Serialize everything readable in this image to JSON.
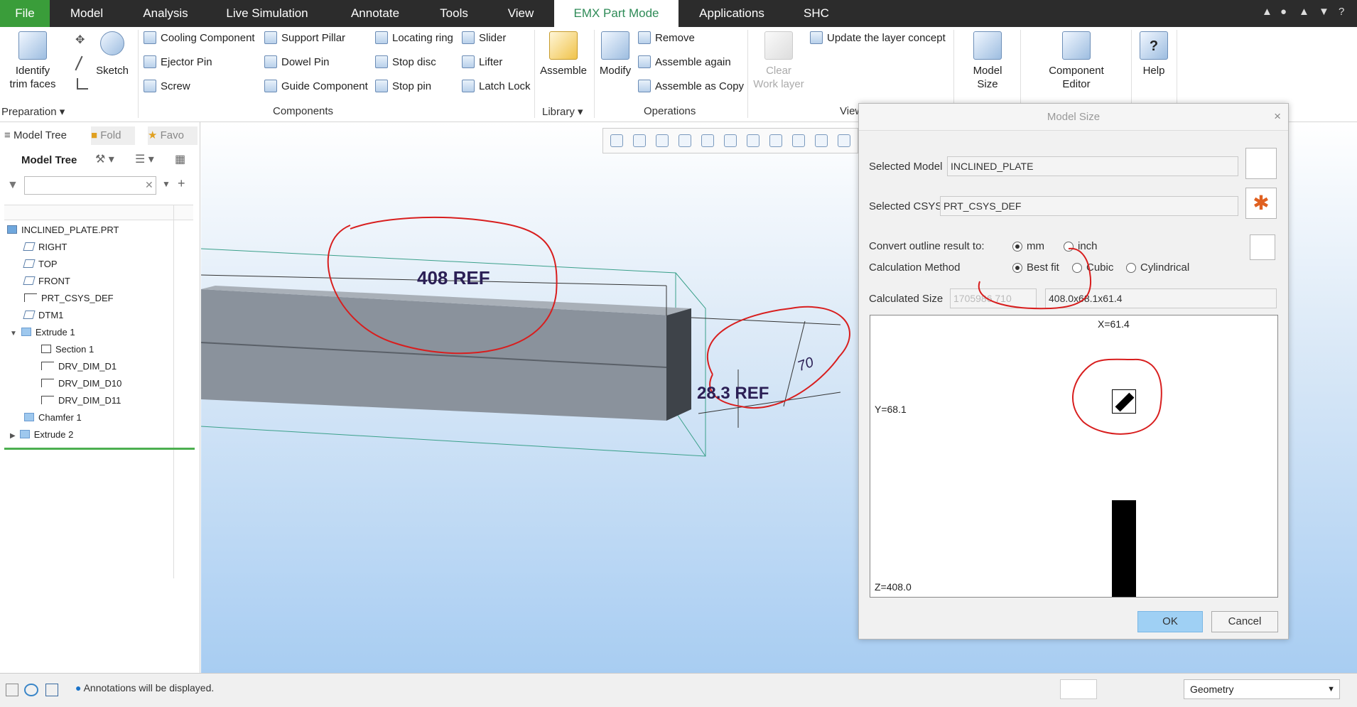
{
  "menubar": {
    "tabs": [
      "File",
      "Model",
      "Analysis",
      "Live Simulation",
      "Annotate",
      "Tools",
      "View",
      "EMX Part Mode",
      "Applications",
      "SHC"
    ],
    "active_tab": "EMX Part Mode",
    "help": "?"
  },
  "ribbon": {
    "identify_trim_faces": "Identify\ntrim faces",
    "sketch": "Sketch",
    "components": {
      "col1": [
        "Cooling Component",
        "Ejector Pin",
        "Screw"
      ],
      "col2": [
        "Support Pillar",
        "Dowel Pin",
        "Guide Component"
      ],
      "col3": [
        "Locating ring",
        "Stop disc",
        "Stop pin"
      ],
      "col4": [
        "Slider",
        "Lifter",
        "Latch Lock"
      ]
    },
    "assemble": "Assemble",
    "modify": "Modify",
    "operations": [
      "Remove",
      "Assemble again",
      "Assemble as Copy"
    ],
    "clear_work_layer": "Clear\nWork layer",
    "update_layer": "Update the layer concept",
    "model_size": "Model\nSize",
    "component_editor": "Component\nEditor",
    "help": "Help",
    "groups": {
      "preparation": "Preparation",
      "components": "Components",
      "library": "Library",
      "operations": "Operations",
      "view": "View"
    }
  },
  "left_panel": {
    "tabs": [
      "Model Tree",
      "Fold",
      "Favo"
    ],
    "tree_header": "Model Tree",
    "search_placeholder": "",
    "items": [
      {
        "label": "INCLINED_PLATE.PRT"
      },
      {
        "label": "RIGHT"
      },
      {
        "label": "TOP"
      },
      {
        "label": "FRONT"
      },
      {
        "label": "PRT_CSYS_DEF"
      },
      {
        "label": "DTM1"
      },
      {
        "label": "Extrude 1"
      },
      {
        "label": "Section 1"
      },
      {
        "label": "DRV_DIM_D1"
      },
      {
        "label": "DRV_DIM_D10"
      },
      {
        "label": "DRV_DIM_D11"
      },
      {
        "label": "Chamfer 1"
      },
      {
        "label": "Extrude 2"
      }
    ]
  },
  "viewport": {
    "dim_408": "408 REF",
    "dim_283": "28.3 REF",
    "dim_70": "70"
  },
  "dialog": {
    "title": "Model Size",
    "close": "×",
    "selected_model_label": "Selected Model",
    "selected_model_value": "INCLINED_PLATE",
    "selected_csys_label": "Selected CSYS",
    "selected_csys_value": "PRT_CSYS_DEF",
    "convert_label": "Convert outline result to:",
    "unit_mm": "mm",
    "unit_inch": "inch",
    "method_label": "Calculation Method",
    "method_bestfit": "Best fit",
    "method_cubic": "Cubic",
    "method_cylindrical": "Cylindrical",
    "calc_size_label": "Calculated Size",
    "calc_size_volume": "1705986.710",
    "calc_size_value": "408.0x68.1x61.4",
    "preview_x": "X=61.4",
    "preview_y": "Y=68.1",
    "preview_z": "Z=408.0",
    "ok": "OK",
    "cancel": "Cancel"
  },
  "statusbar": {
    "message": "Annotations will be displayed.",
    "filter_value": "Geometry"
  }
}
